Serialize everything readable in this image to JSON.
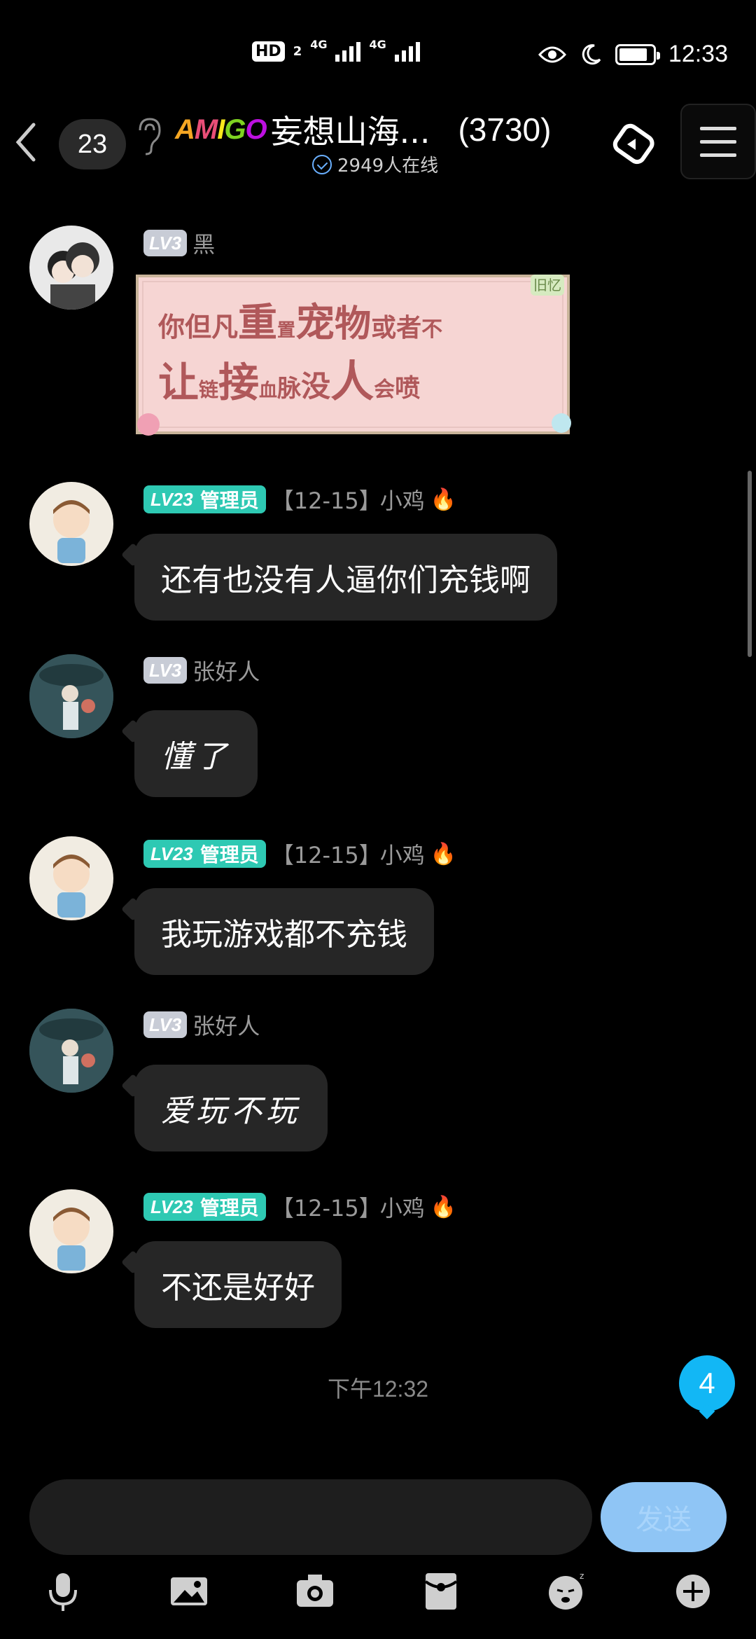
{
  "status_bar": {
    "hd": "HD",
    "hd_sub": "2",
    "net1": "4G",
    "net2": "4G",
    "time": "12:33",
    "battery_level": 0.85
  },
  "header": {
    "unread_count": "23",
    "brand": [
      "A",
      "M",
      "I",
      "G",
      "O"
    ],
    "group_name": "妄想山海...",
    "member_count": "(3730)",
    "online_text": "2949人在线"
  },
  "messages": [
    {
      "level": "LV3",
      "name": "黑",
      "sticker_text_1": [
        "你",
        "但",
        "凡",
        "重",
        "置",
        "宠",
        "物",
        "或",
        "者",
        "不"
      ],
      "sticker_text_2": [
        "让",
        "链",
        "接",
        "血",
        "脉",
        "没",
        "人",
        "会",
        "喷"
      ],
      "sticker_tag": "旧忆"
    },
    {
      "level": "LV23",
      "role": "管理员",
      "title": "【12-15】",
      "name": "小鸡",
      "text": "还有也没有人逼你们充钱啊"
    },
    {
      "level": "LV3",
      "name": "张好人",
      "text": "懂了"
    },
    {
      "level": "LV23",
      "role": "管理员",
      "title": "【12-15】",
      "name": "小鸡",
      "text": "我玩游戏都不充钱"
    },
    {
      "level": "LV3",
      "name": "张好人",
      "text": "爱玩不玩"
    },
    {
      "level": "LV23",
      "role": "管理员",
      "title": "【12-15】",
      "name": "小鸡",
      "text": "不还是好好"
    }
  ],
  "timestamp": "下午12:32",
  "new_badge": "4",
  "input": {
    "value": "",
    "placeholder": ""
  },
  "send_label": "发送",
  "fire_glyph": "🔥",
  "colors": {
    "accent": "#12b7f5",
    "admin": "#2ec9b3",
    "bubble": "#262626",
    "send": "#8fc5f5"
  },
  "toolbar_icons": [
    "mic-icon",
    "image-icon",
    "camera-icon",
    "red-packet-icon",
    "emoji-icon",
    "plus-icon"
  ]
}
